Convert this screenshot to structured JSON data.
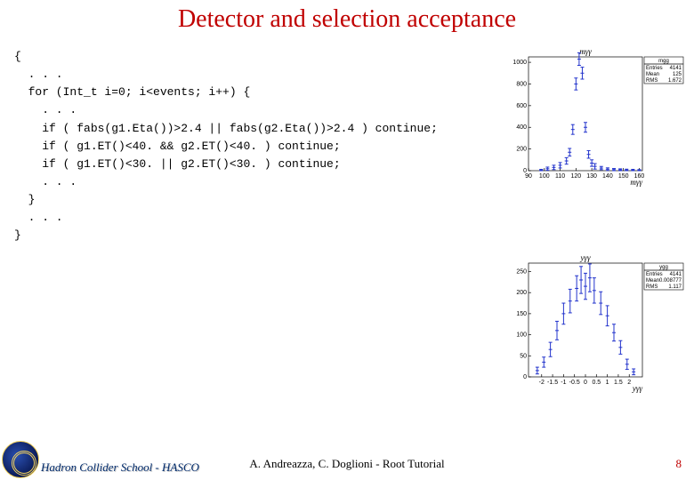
{
  "title": "Detector and selection acceptance",
  "code": {
    "l0": "{",
    "l1": "  . . .",
    "l2": "  for (Int_t i=0; i<events; i++) {",
    "l3": "    . . .",
    "l4": "    if ( fabs(g1.Eta())>2.4 || fabs(g2.Eta())>2.4 ) continue;",
    "l5": "    if ( g1.ET()<40. && g2.ET()<40. ) continue;",
    "l6": "    if ( g1.ET()<30. || g2.ET()<30. ) continue;",
    "l7": "    . . .",
    "l8": "  }",
    "l9": "  . . .",
    "l10": "}"
  },
  "chart_data": [
    {
      "type": "scatter",
      "title": "m_{γγ}",
      "xlabel": "m_{γγ}",
      "ylabel": "",
      "xlim": [
        90,
        162
      ],
      "ylim": [
        0,
        1050
      ],
      "xticks": [
        90,
        100,
        110,
        120,
        130,
        140,
        150,
        160
      ],
      "yticks": [
        0,
        200,
        400,
        600,
        800,
        1000
      ],
      "series": [
        {
          "name": "mgg",
          "x": [
            98,
            102,
            106,
            110,
            114,
            116,
            118,
            120,
            122,
            124,
            126,
            128,
            130,
            132,
            136,
            140,
            144,
            148,
            152,
            156,
            160
          ],
          "y": [
            6,
            18,
            30,
            50,
            90,
            170,
            380,
            800,
            1030,
            900,
            400,
            150,
            70,
            40,
            24,
            14,
            10,
            8,
            6,
            5,
            4
          ],
          "ey": [
            6,
            15,
            20,
            25,
            30,
            35,
            45,
            55,
            58,
            55,
            45,
            35,
            30,
            25,
            15,
            12,
            10,
            9,
            8,
            7,
            6
          ]
        }
      ],
      "stats": {
        "title": "mgg",
        "Entries": "4141",
        "Mean": "125",
        "RMS": "1.672"
      }
    },
    {
      "type": "scatter",
      "title": "y_{γγ}",
      "xlabel": "y_{γγ}",
      "ylabel": "",
      "xlim": [
        -2.6,
        2.6
      ],
      "ylim": [
        0,
        270
      ],
      "xticks": [
        -2,
        -1.5,
        -1,
        -0.5,
        0,
        0.5,
        1,
        1.5,
        2
      ],
      "yticks": [
        0,
        50,
        100,
        150,
        200,
        250
      ],
      "series": [
        {
          "name": "ygg",
          "x": [
            -2.2,
            -1.9,
            -1.6,
            -1.3,
            -1.0,
            -0.7,
            -0.4,
            -0.2,
            0.0,
            0.2,
            0.4,
            0.7,
            1.0,
            1.3,
            1.6,
            1.9,
            2.2
          ],
          "y": [
            15,
            35,
            65,
            110,
            150,
            180,
            210,
            230,
            215,
            235,
            205,
            175,
            145,
            105,
            70,
            30,
            12
          ],
          "ey": [
            8,
            12,
            17,
            22,
            25,
            28,
            30,
            32,
            31,
            33,
            30,
            27,
            24,
            20,
            16,
            12,
            7
          ]
        }
      ],
      "stats": {
        "title": "ygg",
        "Entries": "4141",
        "Mean": "0.008777",
        "RMS": "1.117"
      }
    }
  ],
  "footer": {
    "school": "Hadron Collider School - HASCO",
    "credit": "A. Andreazza, C. Doglioni - Root Tutorial",
    "page": "8"
  }
}
